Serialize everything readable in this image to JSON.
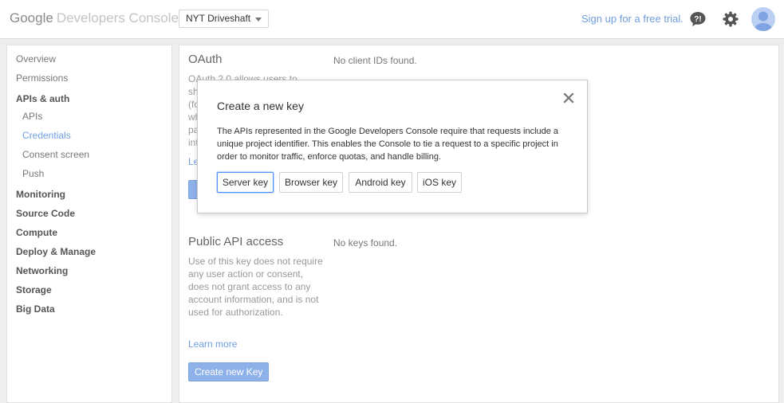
{
  "header": {
    "logo_google": "Google",
    "logo_product": "Developers Console",
    "project_name": "NYT Driveshaft",
    "signup_link": "Sign up for a free trial.",
    "icons": [
      "help-icon",
      "gear-icon",
      "avatar"
    ]
  },
  "sidebar": {
    "items": [
      {
        "label": "Overview"
      },
      {
        "label": "Permissions"
      },
      {
        "label": "APIs & auth"
      },
      {
        "label": "APIs"
      },
      {
        "label": "Credentials"
      },
      {
        "label": "Consent screen"
      },
      {
        "label": "Push"
      },
      {
        "label": "Monitoring"
      },
      {
        "label": "Source Code"
      },
      {
        "label": "Compute"
      },
      {
        "label": "Deploy & Manage"
      },
      {
        "label": "Networking"
      },
      {
        "label": "Storage"
      },
      {
        "label": "Big Data"
      }
    ],
    "active_item": "Credentials"
  },
  "oauth": {
    "title": "OAuth",
    "empty_text": "No client IDs found.",
    "desc_line1": "OAuth 2.0 allows users to",
    "desc_frag2": "sh",
    "desc_frag3": "(fo",
    "desc_frag4": "wh",
    "desc_frag5": "pa",
    "desc_frag6": "int",
    "link_frag": "Le"
  },
  "public_api": {
    "title": "Public API access",
    "empty_text": "No keys found.",
    "description": "Use of this key does not require any user action or consent, does not grant access to any account information, and is not used for authorization.",
    "learn_more": "Learn more",
    "create_button": "Create new Key"
  },
  "modal": {
    "title": "Create a new key",
    "body": "The APIs represented in the Google Developers Console require that requests include a unique project identifier. This enables the Console to tie a request to a specific project in order to monitor traffic, enforce quotas, and handle billing.",
    "buttons": [
      {
        "label": "Server key"
      },
      {
        "label": "Browser key"
      },
      {
        "label": "Android key"
      },
      {
        "label": "iOS key"
      }
    ],
    "focused_button": "Server key"
  },
  "colors": {
    "accent_link": "#6f9ee0",
    "primary_button": "#8fb1ea",
    "focus_ring": "#4d90fe"
  }
}
